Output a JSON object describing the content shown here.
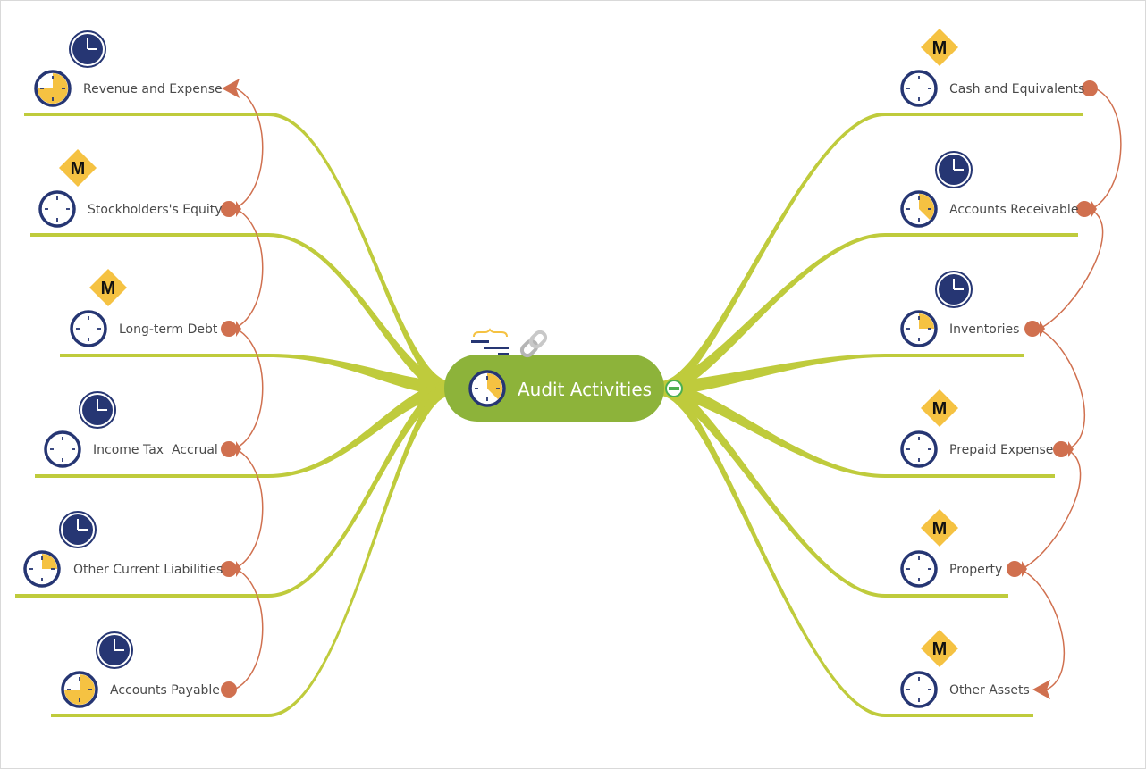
{
  "diagram": {
    "type": "mind-map",
    "central_topic": {
      "label": "Audit Activities",
      "progress_icon": "clock-three-quarter-remaining",
      "progress_fraction": 0.375,
      "attachments": [
        "note-icon",
        "link-icon"
      ],
      "collapse_control": "minus-icon"
    },
    "colors": {
      "branch": "#bfcb3c",
      "central_fill": "#8db33a",
      "relation": "#d0704f",
      "clock_ring": "#263673",
      "clock_fill": "#f5c242",
      "milestone": "#f5c242",
      "collapse": "#4caf50",
      "text": "#4a4a4a"
    },
    "left_topics": [
      {
        "label": "Revenue and Expense",
        "marker": "clock",
        "progress": 0.75,
        "progress_icon_fill": "three-quarters"
      },
      {
        "label": "Stockholders's Equity",
        "marker": "milestone",
        "progress": 0.0
      },
      {
        "label": "Long-term Debt",
        "marker": "milestone",
        "progress": 0.0
      },
      {
        "label": "Income Tax  Accrual",
        "marker": "clock",
        "progress": 0.0
      },
      {
        "label": "Other Current Liabilities",
        "marker": "clock",
        "progress": 0.25
      },
      {
        "label": "Accounts Payable",
        "marker": "clock",
        "progress": 0.75
      }
    ],
    "right_topics": [
      {
        "label": "Cash and Equivalents",
        "marker": "milestone",
        "progress": 0.0
      },
      {
        "label": "Accounts Receivable",
        "marker": "clock",
        "progress": 0.375
      },
      {
        "label": "Inventories",
        "marker": "clock",
        "progress": 0.25
      },
      {
        "label": "Prepaid Expense",
        "marker": "milestone",
        "progress": 0.0
      },
      {
        "label": "Property",
        "marker": "milestone",
        "progress": 0.0
      },
      {
        "label": "Other Assets",
        "marker": "milestone",
        "progress": 0.0
      }
    ],
    "milestone_letter": "M",
    "relations": [
      {
        "from": "Accounts Payable",
        "to": "Other Current Liabilities"
      },
      {
        "from": "Other Current Liabilities",
        "to": "Income Tax  Accrual"
      },
      {
        "from": "Income Tax  Accrual",
        "to": "Long-term Debt"
      },
      {
        "from": "Long-term Debt",
        "to": "Stockholders's Equity"
      },
      {
        "from": "Stockholders's Equity",
        "to": "Revenue and Expense"
      },
      {
        "from": "Cash and Equivalents",
        "to": "Accounts Receivable"
      },
      {
        "from": "Accounts Receivable",
        "to": "Inventories"
      },
      {
        "from": "Inventories",
        "to": "Prepaid Expense"
      },
      {
        "from": "Prepaid Expense",
        "to": "Property"
      },
      {
        "from": "Property",
        "to": "Other Assets"
      }
    ]
  }
}
